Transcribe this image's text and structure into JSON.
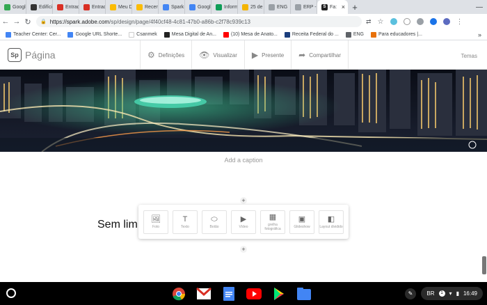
{
  "browser": {
    "tabs": [
      {
        "label": "Google",
        "color": "#34a853",
        "icon": "maps-icon"
      },
      {
        "label": "Edifíci",
        "color": "#333333",
        "icon": "spark-icon"
      },
      {
        "label": "Entrad",
        "color": "#d93025",
        "icon": "gmail-icon"
      },
      {
        "label": "Entrad",
        "color": "#d93025",
        "icon": "gmail-icon"
      },
      {
        "label": "Meu D",
        "color": "#fbbc04",
        "icon": "drive-icon"
      },
      {
        "label": "Recen",
        "color": "#fbbc04",
        "icon": "drive-icon"
      },
      {
        "label": "Spark",
        "color": "#4285f4",
        "icon": "docs-icon"
      },
      {
        "label": "Googl",
        "color": "#4285f4",
        "icon": "docs-icon"
      },
      {
        "label": "Inform",
        "color": "#0f9d58",
        "icon": "sheets-icon"
      },
      {
        "label": "25 de",
        "color": "#f4b400",
        "icon": "slides-icon"
      },
      {
        "label": "ENG",
        "color": "#9aa0a6",
        "icon": "page-icon"
      },
      {
        "label": "ERP -",
        "color": "#9aa0a6",
        "icon": "page-icon"
      }
    ],
    "active_tab": {
      "label": "Fa:",
      "color": "#222222"
    },
    "url_host": "https://spark.adobe.com",
    "url_path": "/sp/design/page/4f40cf48-4c81-47b0-a86b-c2f78c939c13",
    "bookmarks": [
      {
        "label": "Teacher Center: Cer...",
        "color": "#4285f4"
      },
      {
        "label": "Google URL Shorte...",
        "color": "#4285f4"
      },
      {
        "label": "Csanmek",
        "color": "#ffffff"
      },
      {
        "label": "Mesa Digital de An...",
        "color": "#222222"
      },
      {
        "label": "(10) Mesa de Anato...",
        "color": "#ff0000"
      },
      {
        "label": "Receita Federal do ...",
        "color": "#1a3d7c"
      },
      {
        "label": "ENG",
        "color": "#5f6368"
      },
      {
        "label": "Para educadores |...",
        "color": "#e8710a"
      }
    ]
  },
  "spark": {
    "logo": "Sp",
    "title": "Página",
    "toolbar": [
      {
        "label": "Definições",
        "icon": "gear-icon"
      },
      {
        "label": "Visualizar",
        "icon": "eye-icon"
      },
      {
        "label": "Presente",
        "icon": "play-icon"
      },
      {
        "label": "Compartilhar",
        "icon": "share-icon"
      }
    ],
    "themes": "Temas",
    "caption": "Add a caption",
    "heading": "Sem lim",
    "picker": [
      {
        "label": "Foto",
        "icon": "photo-icon",
        "glyph": "🖼"
      },
      {
        "label": "Texto",
        "icon": "text-icon",
        "glyph": "T"
      },
      {
        "label": "Botão",
        "icon": "button-icon",
        "glyph": "⬭"
      },
      {
        "label": "Vídeo",
        "icon": "video-icon",
        "glyph": "▶"
      },
      {
        "label": "grelha fotográfica",
        "icon": "photo-grid-icon",
        "glyph": "▦"
      },
      {
        "label": "Glideshow",
        "icon": "glideshow-icon",
        "glyph": "▣"
      },
      {
        "label": "Layout dividido",
        "icon": "split-layout-icon",
        "glyph": "◧"
      }
    ]
  },
  "shelf": {
    "apps": [
      "chrome-icon",
      "gmail-icon",
      "docs-icon",
      "youtube-icon",
      "play-store-icon",
      "files-icon"
    ],
    "locale": "BR",
    "time": "16:49"
  }
}
